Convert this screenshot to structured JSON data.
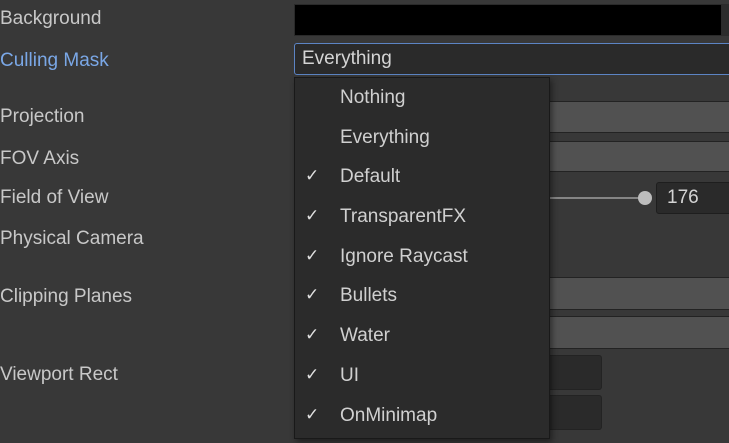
{
  "properties": {
    "background": "Background",
    "culling_mask": "Culling Mask",
    "projection": "Projection",
    "fov_axis": "FOV Axis",
    "field_of_view": "Field of View",
    "physical_camera": "Physical Camera",
    "clipping_planes": "Clipping Planes",
    "viewport_rect": "Viewport Rect"
  },
  "culling_mask_value": "Everything",
  "field_of_view_value": "176",
  "field_of_view_slider_fraction": 0.98,
  "dropdown": {
    "items": [
      {
        "label": "Nothing",
        "checked": false
      },
      {
        "label": "Everything",
        "checked": false
      },
      {
        "label": "Default",
        "checked": true
      },
      {
        "label": "TransparentFX",
        "checked": true
      },
      {
        "label": "Ignore Raycast",
        "checked": true
      },
      {
        "label": "Bullets",
        "checked": true
      },
      {
        "label": "Water",
        "checked": true
      },
      {
        "label": "UI",
        "checked": true
      },
      {
        "label": "OnMinimap",
        "checked": true
      }
    ],
    "check_glyph": "✓"
  },
  "colors": {
    "panel_bg": "#383838",
    "label_text": "#c8c8c8",
    "active_label": "#7aa7e6",
    "menu_bg": "#2b2b2b",
    "focus_border": "#5c84c4"
  }
}
